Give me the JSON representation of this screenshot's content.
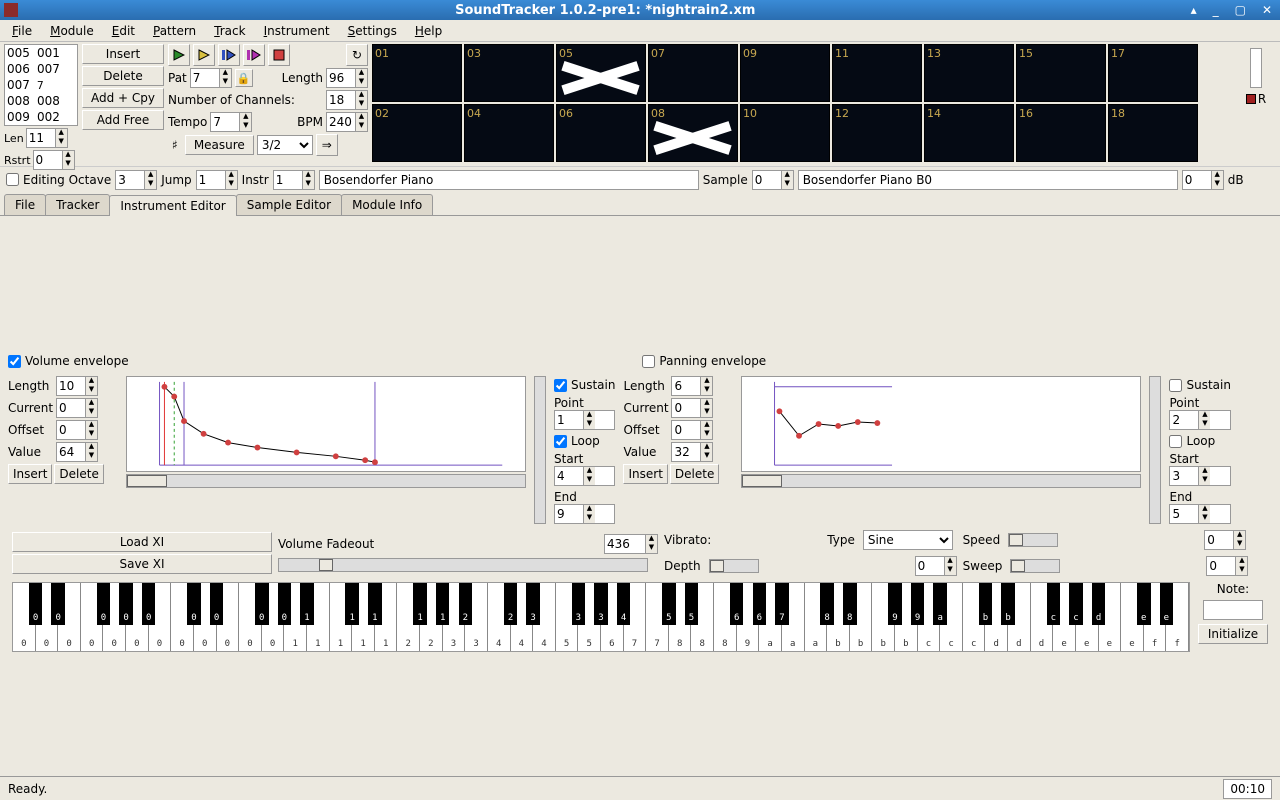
{
  "title": "SoundTracker 1.0.2-pre1: *nightrain2.xm",
  "menu": [
    "File",
    "Module",
    "Edit",
    "Pattern",
    "Track",
    "Instrument",
    "Settings",
    "Help"
  ],
  "orderlist": {
    "rows": [
      [
        "005",
        "001"
      ],
      [
        "006",
        "007"
      ],
      [
        "007",
        "7"
      ],
      [
        "008",
        "008"
      ],
      [
        "009",
        "002"
      ]
    ],
    "len_label": "Len",
    "len": "11",
    "rstrt_label": "Rstrt",
    "rstrt": "0"
  },
  "btncol": {
    "insert": "Insert",
    "delete": "Delete",
    "addcpy": "Add + Cpy",
    "addfree": "Add Free"
  },
  "play": {
    "pat_label": "Pat",
    "pat": "7",
    "length_label": "Length",
    "length": "96",
    "nchan_label": "Number of Channels:",
    "nchan": "18",
    "tempo_label": "Tempo",
    "tempo": "7",
    "bpm_label": "BPM",
    "bpm": "240",
    "measure_label": "Measure",
    "measure": "3/2"
  },
  "tracks": {
    "row1": [
      {
        "n": "01"
      },
      {
        "n": "03"
      },
      {
        "n": "05",
        "x": true
      },
      {
        "n": "07"
      },
      {
        "n": "09"
      },
      {
        "n": "11"
      },
      {
        "n": "13"
      },
      {
        "n": "15"
      },
      {
        "n": "17"
      }
    ],
    "row2": [
      {
        "n": "02"
      },
      {
        "n": "04"
      },
      {
        "n": "06"
      },
      {
        "n": "08",
        "x": true
      },
      {
        "n": "10"
      },
      {
        "n": "12"
      },
      {
        "n": "14"
      },
      {
        "n": "16"
      },
      {
        "n": "18"
      }
    ]
  },
  "sidebar_r": "R",
  "params": {
    "editoct_label": "Editing Octave",
    "editoct": "3",
    "jump_label": "Jump",
    "jump": "1",
    "instr_label": "Instr",
    "instr": "1",
    "instr_name": "Bosendorfer Piano",
    "sample_label": "Sample",
    "sample": "0",
    "sample_name": "Bosendorfer Piano B0",
    "db": "0",
    "db_label": "dB"
  },
  "tabs": [
    "File",
    "Tracker",
    "Instrument Editor",
    "Sample Editor",
    "Module Info"
  ],
  "active_tab": 2,
  "volenv": {
    "title": "Volume envelope",
    "checked": true,
    "length_label": "Length",
    "length": "10",
    "current_label": "Current",
    "current": "0",
    "offset_label": "Offset",
    "offset": "0",
    "value_label": "Value",
    "value": "64",
    "insert": "Insert",
    "delete": "Delete",
    "sustain": "Sustain",
    "sustain_on": true,
    "loop": "Loop",
    "loop_on": true,
    "point_label": "Point",
    "point": "1",
    "start_label": "Start",
    "start": "4",
    "end_label": "End",
    "end": "9"
  },
  "panenv": {
    "title": "Panning envelope",
    "checked": false,
    "length_label": "Length",
    "length": "6",
    "current_label": "Current",
    "current": "0",
    "offset_label": "Offset",
    "offset": "0",
    "value_label": "Value",
    "value": "32",
    "insert": "Insert",
    "delete": "Delete",
    "sustain": "Sustain",
    "sustain_on": false,
    "loop": "Loop",
    "loop_on": false,
    "point_label": "Point",
    "point": "2",
    "start_label": "Start",
    "start": "3",
    "end_label": "End",
    "end": "5"
  },
  "bottom": {
    "loadxi": "Load XI",
    "savexi": "Save XI",
    "fadeout_label": "Volume Fadeout",
    "fadeout": "436",
    "vibrato_label": "Vibrato:",
    "type_label": "Type",
    "type": "Sine",
    "speed_label": "Speed",
    "speed": "0",
    "depth_label": "Depth",
    "depth": "0",
    "sweep_label": "Sweep",
    "sweep": "0"
  },
  "keyboard": {
    "note_label": "Note:",
    "init": "Initialize",
    "white_labels": [
      "0",
      "0",
      "0",
      "0",
      "0",
      "0",
      "0",
      "0",
      "0",
      "0",
      "0",
      "0",
      "1",
      "1",
      "1",
      "1",
      "1",
      "2",
      "2",
      "3",
      "3",
      "4",
      "4",
      "4",
      "5",
      "5",
      "6",
      "7",
      "7",
      "8",
      "8",
      "8",
      "9",
      "a",
      "a",
      "a",
      "b",
      "b",
      "b",
      "b",
      "c",
      "c",
      "c",
      "d",
      "d",
      "d",
      "e",
      "e",
      "e",
      "e",
      "f",
      "f"
    ],
    "black_labels": [
      "0",
      "0",
      "0",
      "0",
      "0",
      "0",
      "0",
      "0",
      "0",
      "1",
      "1",
      "1",
      "1",
      "1",
      "2",
      "2",
      "3",
      "3",
      "3",
      "4",
      "5",
      "5",
      "6",
      "6",
      "7",
      "8",
      "8",
      "9",
      "9",
      "a",
      "b",
      "b",
      "c",
      "c",
      "d",
      "e",
      "e"
    ]
  },
  "status": "Ready.",
  "time": "00:10",
  "chart_data": [
    {
      "type": "line",
      "title": "Volume envelope",
      "xlim": [
        0,
        9
      ],
      "ylim": [
        0,
        64
      ],
      "series": [
        {
          "name": "vol",
          "x": [
            0,
            1,
            2,
            3,
            4,
            5,
            6,
            7,
            8,
            9
          ],
          "y": [
            64,
            56,
            40,
            30,
            22,
            18,
            14,
            10,
            7,
            5
          ]
        }
      ],
      "markers": {
        "current": 0,
        "sustain": 1,
        "loop_start": 4,
        "loop_end": 9
      }
    },
    {
      "type": "line",
      "title": "Panning envelope",
      "xlim": [
        0,
        5
      ],
      "ylim": [
        0,
        64
      ],
      "series": [
        {
          "name": "pan",
          "x": [
            0,
            1,
            2,
            3,
            4,
            5
          ],
          "y": [
            41,
            32,
            36,
            36,
            37,
            37
          ]
        }
      ]
    }
  ]
}
